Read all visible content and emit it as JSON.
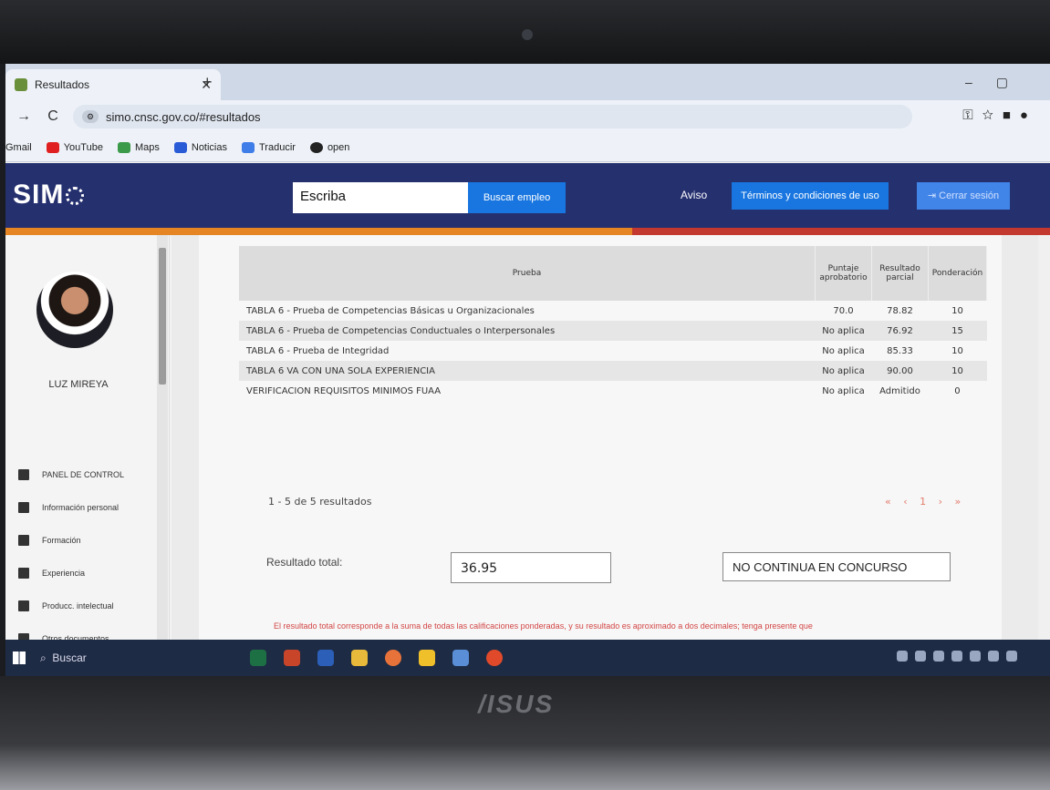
{
  "browser": {
    "tab_title": "Resultados",
    "url": "simo.cnsc.gov.co/#resultados",
    "bookmarks": [
      "Gmail",
      "YouTube",
      "Maps",
      "Noticias",
      "Traducir",
      "open"
    ]
  },
  "header": {
    "logo": "SIM",
    "search_value": "Escriba",
    "search_button": "Buscar empleo",
    "aviso": "Aviso",
    "terms_button": "Términos y condiciones de uso",
    "logout_button": "Cerrar sesión"
  },
  "sidebar": {
    "username": "LUZ MIREYA",
    "items": [
      {
        "label": "PANEL DE CONTROL"
      },
      {
        "label": "Información personal"
      },
      {
        "label": "Formación"
      },
      {
        "label": "Experiencia"
      },
      {
        "label": "Producc. intelectual"
      },
      {
        "label": "Otros documentos"
      }
    ]
  },
  "table": {
    "headers": {
      "prueba": "Prueba",
      "puntaje": "Puntaje aprobatorio",
      "resultado": "Resultado parcial",
      "ponderacion": "Ponderación"
    },
    "rows": [
      {
        "prueba": "TABLA 6 - Prueba de Competencias Básicas u Organizacionales",
        "puntaje": "70.0",
        "resultado": "78.82",
        "ponderacion": "10"
      },
      {
        "prueba": "TABLA 6 - Prueba de Competencias Conductuales o Interpersonales",
        "puntaje": "No aplica",
        "resultado": "76.92",
        "ponderacion": "15"
      },
      {
        "prueba": "TABLA 6 - Prueba de Integridad",
        "puntaje": "No aplica",
        "resultado": "85.33",
        "ponderacion": "10"
      },
      {
        "prueba": "TABLA 6 VA CON UNA SOLA EXPERIENCIA",
        "puntaje": "No aplica",
        "resultado": "90.00",
        "ponderacion": "10"
      },
      {
        "prueba": "VERIFICACION REQUISITOS MINIMOS FUAA",
        "puntaje": "No aplica",
        "resultado": "Admitido",
        "ponderacion": "0"
      }
    ]
  },
  "pagination": {
    "info": "1 - 5 de 5 resultados",
    "pager": "« ‹ 1 › »"
  },
  "result": {
    "label": "Resultado total:",
    "total": "36.95",
    "status": "NO CONTINUA EN CONCURSO",
    "note": "El resultado total corresponde a la suma de todas las calificaciones ponderadas, y su resultado es aproximado a dos decimales; tenga presente que"
  },
  "taskbar": {
    "search_label": "Buscar"
  },
  "laptop": {
    "brand": "/ISUS"
  }
}
